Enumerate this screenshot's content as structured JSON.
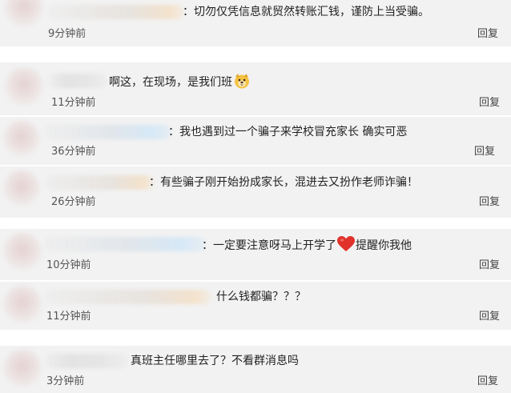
{
  "comments": [
    {
      "text": "：切勿仅凭信息就贸然转账汇钱，谨防上当受骗。",
      "time": "9分钟前",
      "reply": "回复"
    },
    {
      "text": "啊这，在现场，是我们班",
      "time": "11分钟前",
      "reply": "回复"
    },
    {
      "text": "：我也遇到过一个骗子来学校冒充家长 确实可恶",
      "time": "36分钟前",
      "reply": "回复"
    },
    {
      "text": "：有些骗子刚开始扮成家长，混进去又扮作老师诈骗！",
      "time": "26分钟前",
      "reply": "回复"
    },
    {
      "text_before": "：一定要注意呀马上开学了",
      "text_after": "提醒你我他",
      "time": "10分钟前",
      "reply": "回复"
    },
    {
      "text": "什么钱都骗？？？",
      "time": "11分钟前",
      "reply": "回复"
    },
    {
      "text": "真班主任哪里去了？不看群消息吗",
      "time": "3分钟前",
      "reply": "回复"
    }
  ],
  "icons": {
    "dog_emoji": "dog-face-emoji",
    "heart_emoji": "red-heart-emoji"
  },
  "colors": {
    "card_bg": "#f2f2f2",
    "heart": "#e0322b"
  }
}
